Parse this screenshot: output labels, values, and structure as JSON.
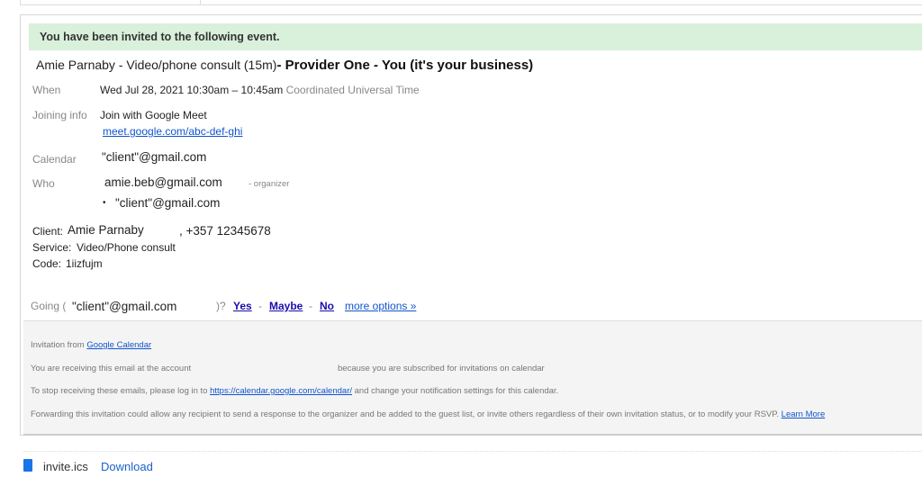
{
  "banner": "You have been invited to the following event.",
  "event": {
    "title_part": "Amie Parnaby - Video/phone consult (15m)",
    "title_bold": "- Provider One - You (it's your business)",
    "when_label": "When",
    "when_value": "Wed Jul 28, 2021 10:30am – 10:45am",
    "timezone": "Coordinated Universal Time",
    "joining_label": "Joining info",
    "joining_value": "Join with Google Meet",
    "meet_link": "meet.google.com/abc-def-ghi",
    "calendar_label": "Calendar",
    "calendar_value": "\"client\"@gmail.com",
    "who_label": "Who",
    "organizer": "amie.beb@gmail.com",
    "organizer_tag": "- organizer",
    "guest": "\"client\"@gmail.com",
    "bullet": "•"
  },
  "details": {
    "client_label": "Client:",
    "client_name": "Amie Parnaby",
    "phone": ", +357 12345678",
    "service_label": "Service:",
    "service": "Video/Phone consult",
    "code_label": "Code:",
    "code": "1iizfujm"
  },
  "rsvp": {
    "going_prefix": "Going (",
    "email": "\"client\"@gmail.com",
    "going_suffix": ")?",
    "yes": "Yes",
    "maybe": "Maybe",
    "no": "No",
    "sep": "-",
    "more": "more options »"
  },
  "footer": {
    "invitation_from": "Invitation from",
    "google_calendar": "Google Calendar",
    "receiving_a": "You are receiving this email at the account",
    "receiving_b": "because you are subscribed for invitations on calendar",
    "stop_a": "To stop receiving these emails, please log in to",
    "stop_link": "https://calendar.google.com/calendar/",
    "stop_b": "and change your notification settings for this calendar.",
    "forward": "Forwarding this invitation could allow any recipient to send a response to the organizer and be added to the guest list, or invite others regardless of their own invitation status, or to modify your RSVP.",
    "learn_more": "Learn More"
  },
  "attachment": {
    "name": "invite.ics",
    "download": "Download",
    "icon": "file-icon",
    "icon_color": "#1a73e8"
  }
}
